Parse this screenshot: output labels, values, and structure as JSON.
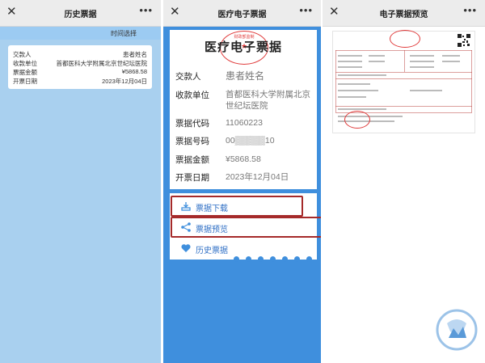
{
  "panel1": {
    "title": "历史票据",
    "filter_label": "时间选择",
    "card": {
      "payer_label": "交款人",
      "payer_value": "患者姓名",
      "unit_label": "收款单位",
      "unit_value": "首都医科大学附属北京世纪坛医院",
      "amount_label": "票据金额",
      "amount_value": "¥5868.58",
      "date_label": "开票日期",
      "date_value": "2023年12月04日"
    }
  },
  "panel2": {
    "title": "医疗电子票据",
    "card_title": "医疗电子票据",
    "stamp_text": "财政部监制",
    "fields": {
      "payer_label": "交款人",
      "payer_value": "患者姓名",
      "unit_label": "收款单位",
      "unit_value": "首都医科大学附属北京世纪坛医院",
      "code_label": "票据代码",
      "code_value": "11060223",
      "number_label": "票据号码",
      "number_value": "00▒▒▒▒▒10",
      "amount_label": "票据金额",
      "amount_value": "¥5868.58",
      "date_label": "开票日期",
      "date_value": "2023年12月04日"
    },
    "menu": {
      "download": "票据下载",
      "preview": "票据预览",
      "history": "历史票据"
    },
    "colors": {
      "accent": "#3f8fdd",
      "highlight": "#a52a2a",
      "stamp": "#e03a3a"
    }
  },
  "panel3": {
    "title": "电子票据预览"
  },
  "icons": {
    "close": "close-icon",
    "more": "more-icon",
    "download": "download-icon",
    "share": "share-icon",
    "heart": "heart-icon"
  }
}
